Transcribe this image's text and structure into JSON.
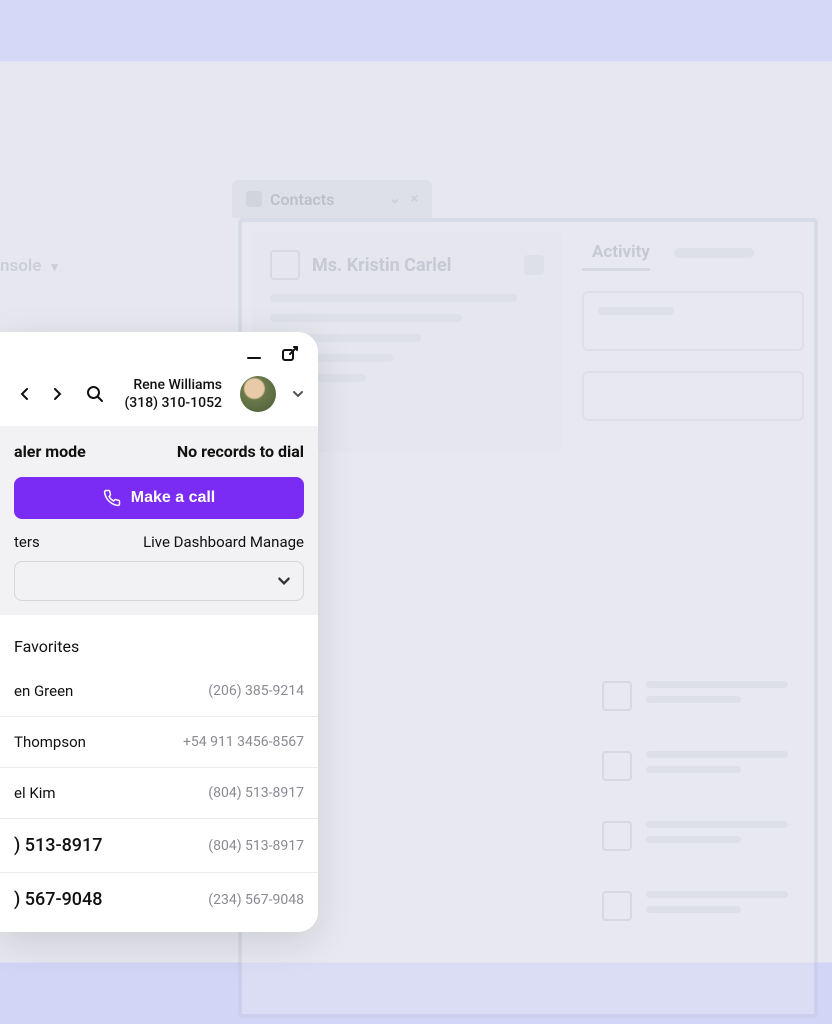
{
  "background": {
    "console_label": "nsole",
    "tab_label": "Contacts",
    "contact_name": "Ms. Kristin Carlel",
    "activity_label": "Activity"
  },
  "dialer": {
    "user": {
      "name": "Rene Williams",
      "phone": "(318) 310-1052"
    },
    "mode_label": "aler mode",
    "status_label": "No records to dial",
    "call_button": "Make a call",
    "links": {
      "left": "ters",
      "right": "Live Dashboard Manage"
    },
    "favorites_header": "Favorites",
    "favorites": [
      {
        "name": "en Green",
        "phone": "(206) 385-9214"
      },
      {
        "name": "Thompson",
        "phone": "+54 911 3456-8567"
      },
      {
        "name": "el Kim",
        "phone": "(804) 513-8917"
      },
      {
        "name": ") 513-8917",
        "phone": "(804) 513-8917"
      },
      {
        "name": ") 567-9048",
        "phone": "(234) 567-9048"
      }
    ]
  }
}
